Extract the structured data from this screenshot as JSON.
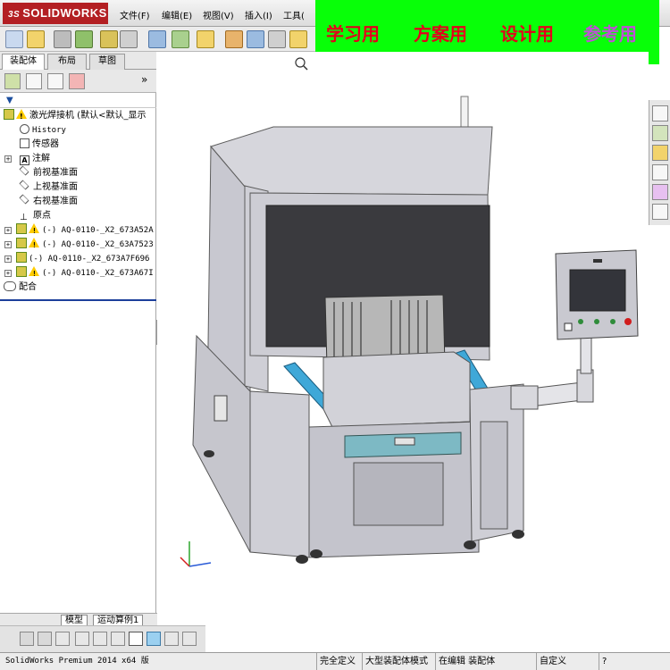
{
  "app": {
    "logo": "SOLIDWORKS",
    "logo_prefix": "3S"
  },
  "menu": [
    "文件(F)",
    "编辑(E)",
    "视图(V)",
    "插入(I)",
    "工具("
  ],
  "banner": {
    "items": [
      "学习用",
      "方案用",
      "设计用",
      "参考用"
    ],
    "colors": [
      "#e3001b",
      "#e3001b",
      "#e3001b",
      "#c04fd6"
    ],
    "background": "#08ff08"
  },
  "left_panel": {
    "tabs": [
      "装配体",
      "布局",
      "草图"
    ],
    "more": "»",
    "tree": [
      {
        "label": "激光焊接机 (默认<默认_显示",
        "icon": "assembly-icon"
      },
      {
        "label": "History",
        "icon": "history-icon"
      },
      {
        "label": "传感器",
        "icon": "sensor-icon"
      },
      {
        "label": "注解",
        "icon": "annotation-icon"
      },
      {
        "label": "前视基准面",
        "icon": "plane-icon"
      },
      {
        "label": "上视基准面",
        "icon": "plane-icon"
      },
      {
        "label": "右视基准面",
        "icon": "plane-icon"
      },
      {
        "label": "原点",
        "icon": "origin-icon"
      },
      {
        "label": "(-) AQ-0110-_X2_673A52A",
        "icon": "part-icon"
      },
      {
        "label": "(-) AQ-0110-_X2_63A7523",
        "icon": "part-icon"
      },
      {
        "label": "(-) AQ-0110-_X2_673A7F696",
        "icon": "part-icon"
      },
      {
        "label": "(-) AQ-0110-_X2_673A67I",
        "icon": "part-icon"
      },
      {
        "label": "配合",
        "icon": "mates-icon"
      }
    ]
  },
  "bottom_tabs": [
    "模型",
    "运动算例1"
  ],
  "status": {
    "app": "SolidWorks Premium 2014 x64 版",
    "fully_defined": "完全定义",
    "large_assembly": "大型装配体模式",
    "editing": "在编辑 装配体",
    "custom": "自定义"
  }
}
